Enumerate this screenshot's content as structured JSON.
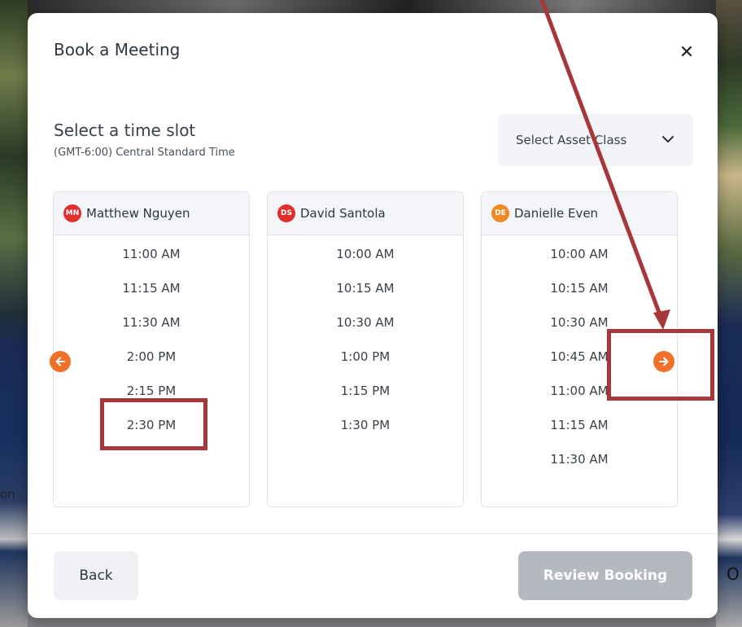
{
  "modal": {
    "title": "Book a Meeting",
    "close_icon": "close-icon",
    "subtitle": "Select a time slot",
    "timezone": "(GMT-6:00) Central Standard Time",
    "asset_class": {
      "label": "Select Asset Class",
      "icon": "chevron-down-icon"
    }
  },
  "hosts": [
    {
      "name": "Matthew Nguyen",
      "initials": "MN",
      "color": "#e0302e",
      "slots": [
        "11:00 AM",
        "11:15 AM",
        "11:30 AM",
        "2:00 PM",
        "2:15 PM",
        "2:30 PM"
      ]
    },
    {
      "name": "David Santola",
      "initials": "DS",
      "color": "#e0302e",
      "slots": [
        "10:00 AM",
        "10:15 AM",
        "10:30 AM",
        "1:00 PM",
        "1:15 PM",
        "1:30 PM"
      ]
    },
    {
      "name": "Danielle Even",
      "initials": "DE",
      "color": "#f08a24",
      "slots": [
        "10:00 AM",
        "10:15 AM",
        "10:30 AM",
        "10:45 AM",
        "11:00 AM",
        "11:15 AM",
        "11:30 AM"
      ]
    }
  ],
  "nav": {
    "prev_icon": "arrow-left-icon",
    "next_icon": "arrow-right-icon",
    "color": "#f0702a"
  },
  "footer": {
    "back_label": "Back",
    "review_label": "Review Booking"
  },
  "background_text": {
    "right": "O",
    "left": "on"
  },
  "annotation_color": "#a8373a"
}
